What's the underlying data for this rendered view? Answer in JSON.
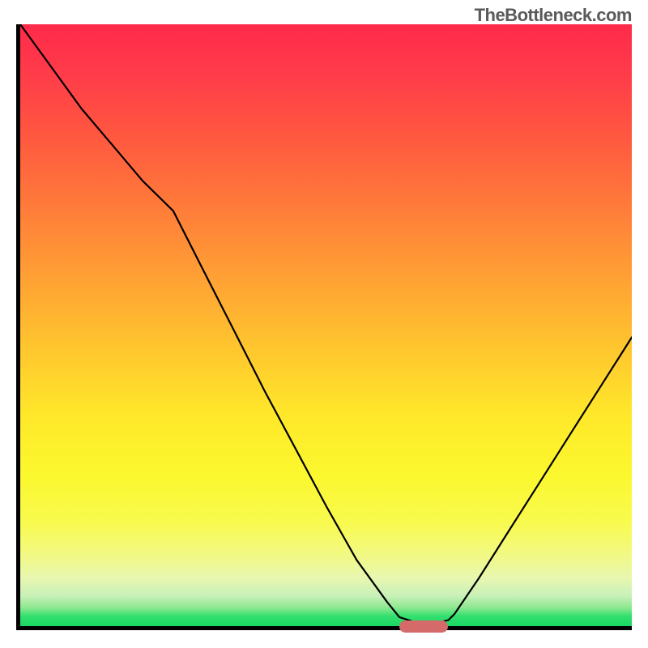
{
  "watermark": "TheBottleneck.com",
  "chart_data": {
    "type": "line",
    "title": "",
    "xlabel": "",
    "ylabel": "",
    "x": [
      0,
      5,
      10,
      15,
      20,
      25,
      30,
      35,
      40,
      45,
      50,
      55,
      60,
      62,
      65,
      68,
      70,
      71,
      75,
      80,
      85,
      90,
      95,
      100
    ],
    "values": [
      100,
      93,
      86,
      80,
      74,
      69,
      59,
      49,
      39,
      29.5,
      20,
      11,
      4,
      1.5,
      0.5,
      0.5,
      1,
      2,
      8,
      16,
      24,
      32,
      40,
      48
    ],
    "ylim": [
      0,
      100
    ],
    "xlim": [
      0,
      100
    ],
    "background_gradient": [
      "#ff2a4a",
      "#ff7a3a",
      "#ffe82a",
      "#f2f982",
      "#35e070",
      "#18d862"
    ],
    "marker": {
      "x_range": [
        62,
        70
      ],
      "y": 0,
      "color": "#d46a6a"
    }
  }
}
